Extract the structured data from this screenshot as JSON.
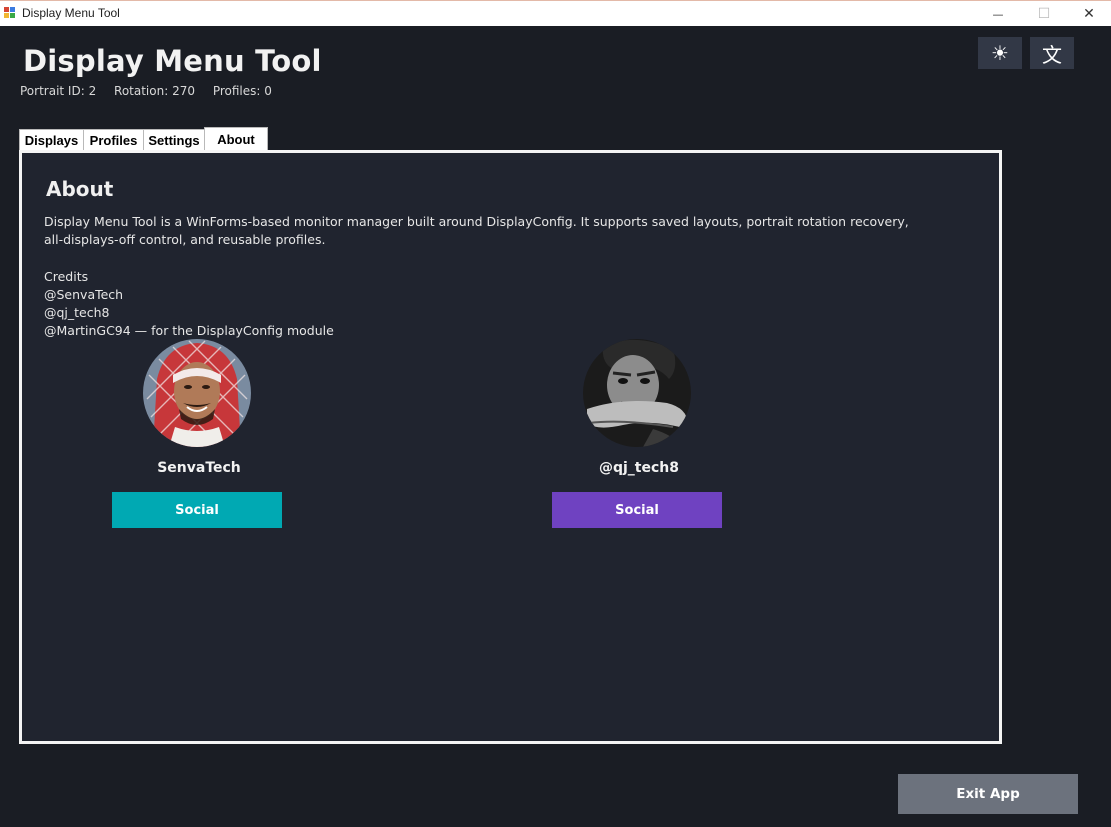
{
  "window": {
    "title": "Display Menu Tool",
    "minimize_glyph": "—",
    "maximize_glyph": "☐",
    "close_glyph": "✕"
  },
  "header": {
    "app_title": "Display Menu Tool",
    "status": {
      "portrait_id": "Portrait ID: 2",
      "rotation": "Rotation: 270",
      "profiles": "Profiles: 0"
    },
    "theme_button_icon": "sun-icon",
    "theme_button_glyph": "☀",
    "language_button_icon": "language-icon",
    "language_button_glyph": "文"
  },
  "tabs": [
    {
      "label": "Displays",
      "active": false
    },
    {
      "label": "Profiles",
      "active": false
    },
    {
      "label": "Settings",
      "active": false
    },
    {
      "label": "About",
      "active": true
    }
  ],
  "about": {
    "heading": "About",
    "description": "Display Menu Tool is a WinForms-based monitor manager built around DisplayConfig. It supports saved layouts, portrait rotation recovery, all-displays-off control, and reusable profiles.",
    "credits_title": "Credits",
    "credits": [
      "@SenvaTech",
      "@qj_tech8",
      "@MartinGC94 — for the DisplayConfig module"
    ],
    "people": [
      {
        "name": "SenvaTech",
        "button_label": "Social",
        "button_color": "#00a9b3"
      },
      {
        "name": "@qj_tech8",
        "button_label": "Social",
        "button_color": "#6f42c1"
      }
    ]
  },
  "footer": {
    "exit_label": "Exit App"
  },
  "colors": {
    "background": "#1a1d24",
    "panel": "#20242f",
    "icon_button": "#323846",
    "exit_button": "#6c727d"
  }
}
